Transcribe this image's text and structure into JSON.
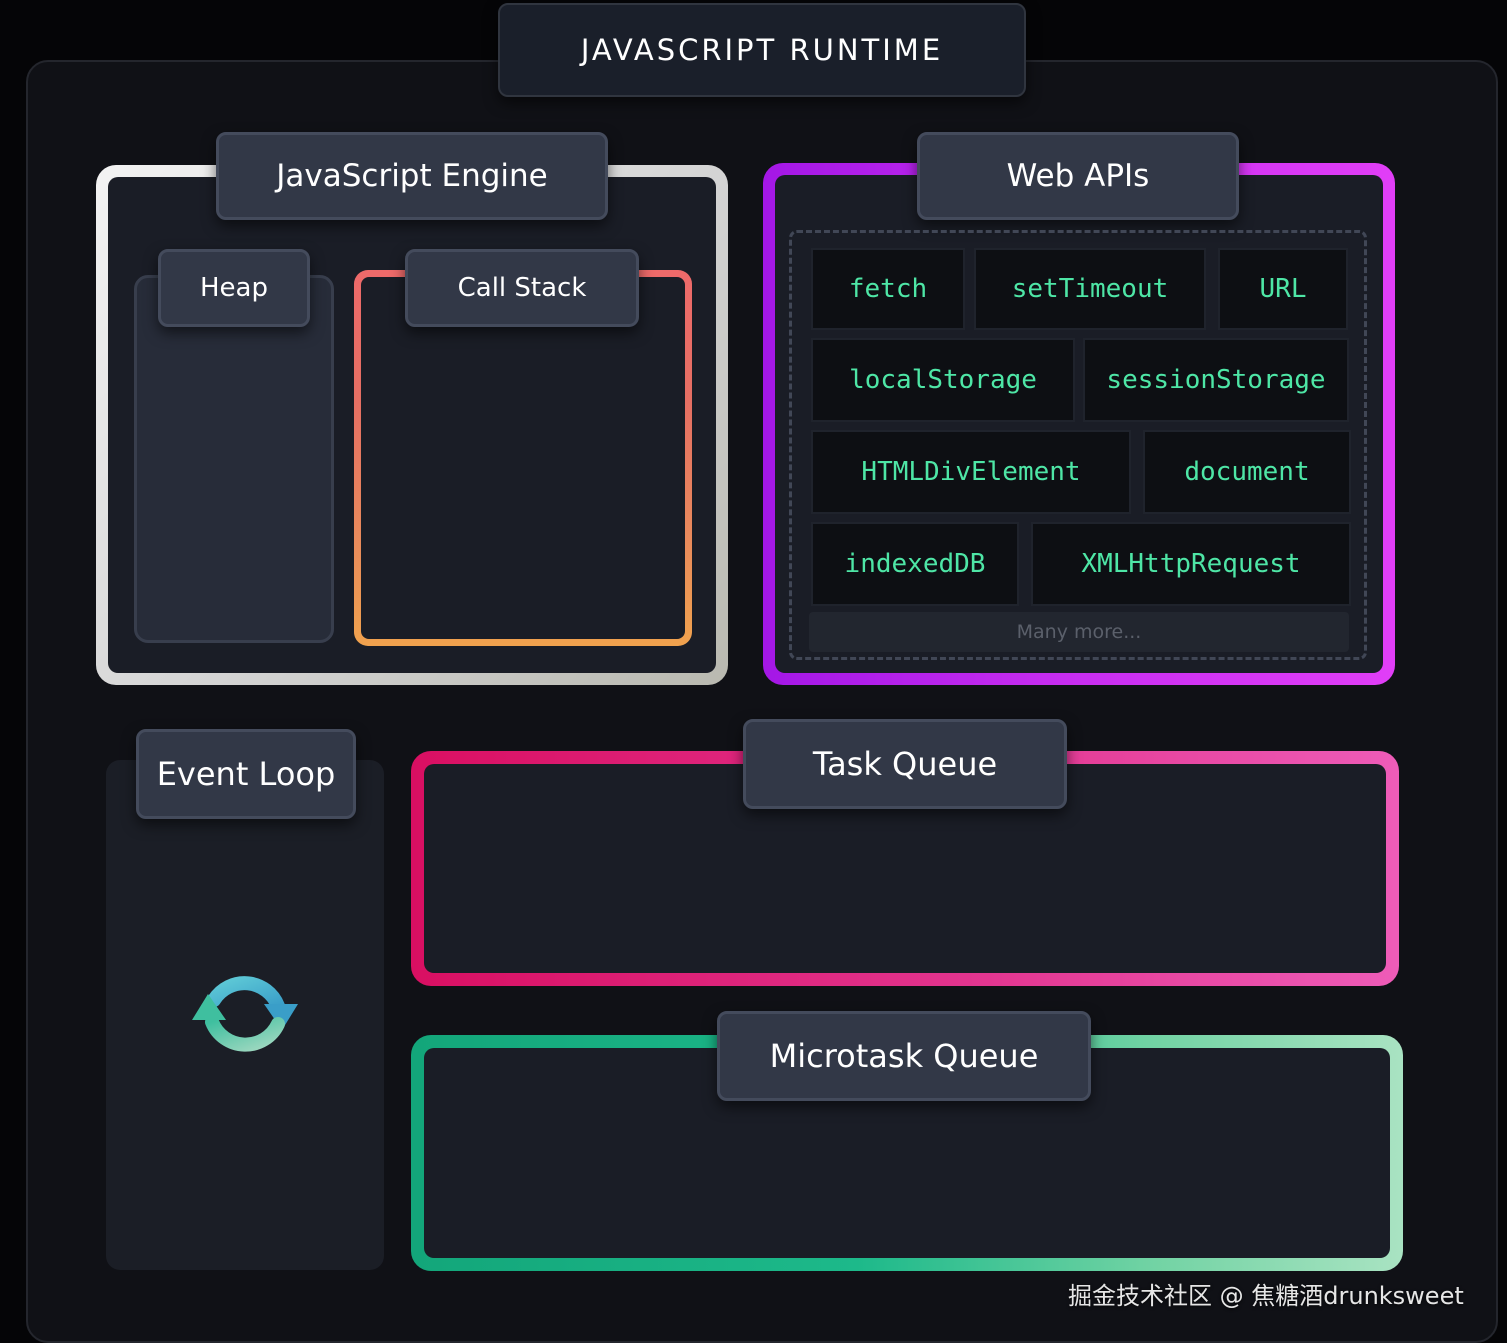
{
  "runtime": {
    "title": "JAVASCRIPT RUNTIME"
  },
  "engine": {
    "title": "JavaScript Engine",
    "heap": {
      "title": "Heap"
    },
    "call_stack": {
      "title": "Call Stack"
    }
  },
  "web_apis": {
    "title": "Web APIs",
    "items": [
      "fetch",
      "setTimeout",
      "URL",
      "localStorage",
      "sessionStorage",
      "HTMLDivElement",
      "document",
      "indexedDB",
      "XMLHttpRequest"
    ],
    "more_label": "Many more..."
  },
  "event_loop": {
    "title": "Event Loop",
    "icon": "refresh-cycle-icon"
  },
  "task_queue": {
    "title": "Task Queue"
  },
  "microtask_queue": {
    "title": "Microtask Queue"
  },
  "watermark": "掘金技术社区 @ 焦糖酒drunksweet",
  "colors": {
    "engine_border": "#e6e6e6",
    "call_stack_border": "#ee6a6a",
    "web_apis_border": "#c62cf0",
    "api_text": "#4ee6a6",
    "task_queue_border": "#e2338d",
    "microtask_queue_border": "#1db98a"
  }
}
